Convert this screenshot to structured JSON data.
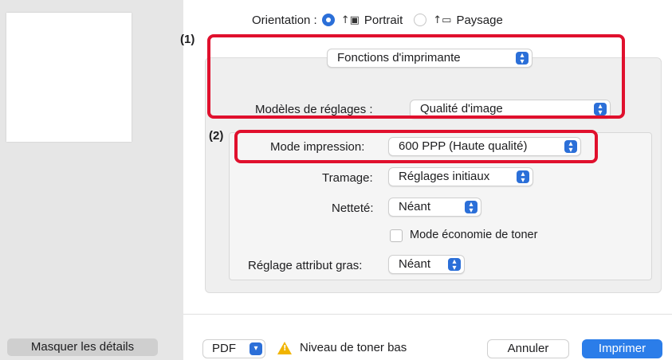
{
  "sidebar": {
    "details_button": "Masquer les détails"
  },
  "orientation": {
    "label": "Orientation :",
    "portrait_label": "Portrait",
    "landscape_label": "Paysage",
    "selected": "Portrait"
  },
  "annotations": {
    "marker1": "(1)",
    "marker2": "(2)",
    "highlight_color": "#e0102d"
  },
  "panel_select": {
    "value": "Fonctions d'imprimante"
  },
  "presets": {
    "label": "Modèles de réglages :",
    "value": "Qualité d'image"
  },
  "settings": {
    "print_mode": {
      "label": "Mode impression:",
      "value": "600 PPP (Haute qualité)"
    },
    "dithering": {
      "label": "Tramage:",
      "value": "Réglages initiaux"
    },
    "sharpness": {
      "label": "Netteté:",
      "value": "Néant"
    },
    "toner_save": {
      "label": "Mode économie de toner",
      "checked": false
    },
    "bold_attr": {
      "label": "Réglage attribut gras:",
      "value": "Néant"
    }
  },
  "footer": {
    "pdf_label": "PDF",
    "warning_text": "Niveau de toner bas",
    "cancel_label": "Annuler",
    "print_label": "Imprimer"
  },
  "colors": {
    "accent": "#2b6fd8",
    "primary_button": "#2b7de9",
    "warning": "#f1b400"
  }
}
